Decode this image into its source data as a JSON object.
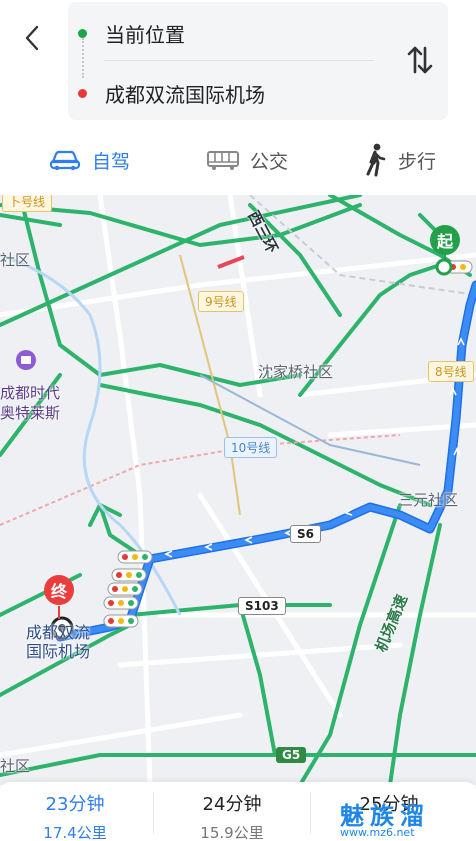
{
  "header": {
    "back_icon": "chevron-left-icon",
    "origin": "当前位置",
    "destination": "成都双流国际机场",
    "origin_dot_color": "#1fa347",
    "destination_dot_color": "#e53935",
    "swap_icon": "swap-vertical-icon"
  },
  "modes": [
    {
      "label": "自驾",
      "icon": "car-icon",
      "active": true
    },
    {
      "label": "公交",
      "icon": "bus-icon",
      "active": false
    },
    {
      "label": "步行",
      "icon": "walk-icon",
      "active": false
    }
  ],
  "map": {
    "labels": {
      "ring_road": "西三环",
      "district_top_left": "社区",
      "shenjiaqiao": "沈家桥社区",
      "sanyuan": "三元社区",
      "outlets": "成都时代\n奥特莱斯",
      "expressway": "机场高速",
      "district_bottom_left": "社区"
    },
    "badges": {
      "metro9": "9号线",
      "metro10": "10号线",
      "metro8": "8号线",
      "s6": "S6",
      "s103": "S103",
      "g5": "G5",
      "top_left_road": "卜号线"
    },
    "start_marker": "起",
    "end_marker": "终",
    "end_label": "成都双流\n国际机场",
    "route_color": "#2f7ef2",
    "road_color": "#2db36b"
  },
  "plans": [
    {
      "time": "23分钟",
      "distance": "17.4公里",
      "selected": true
    },
    {
      "time": "24分钟",
      "distance": "15.9公里",
      "selected": false
    },
    {
      "time": "25分钟",
      "distance": "",
      "selected": false
    }
  ],
  "watermark": {
    "main": "魅族溜",
    "url": "www.mz6.net"
  }
}
